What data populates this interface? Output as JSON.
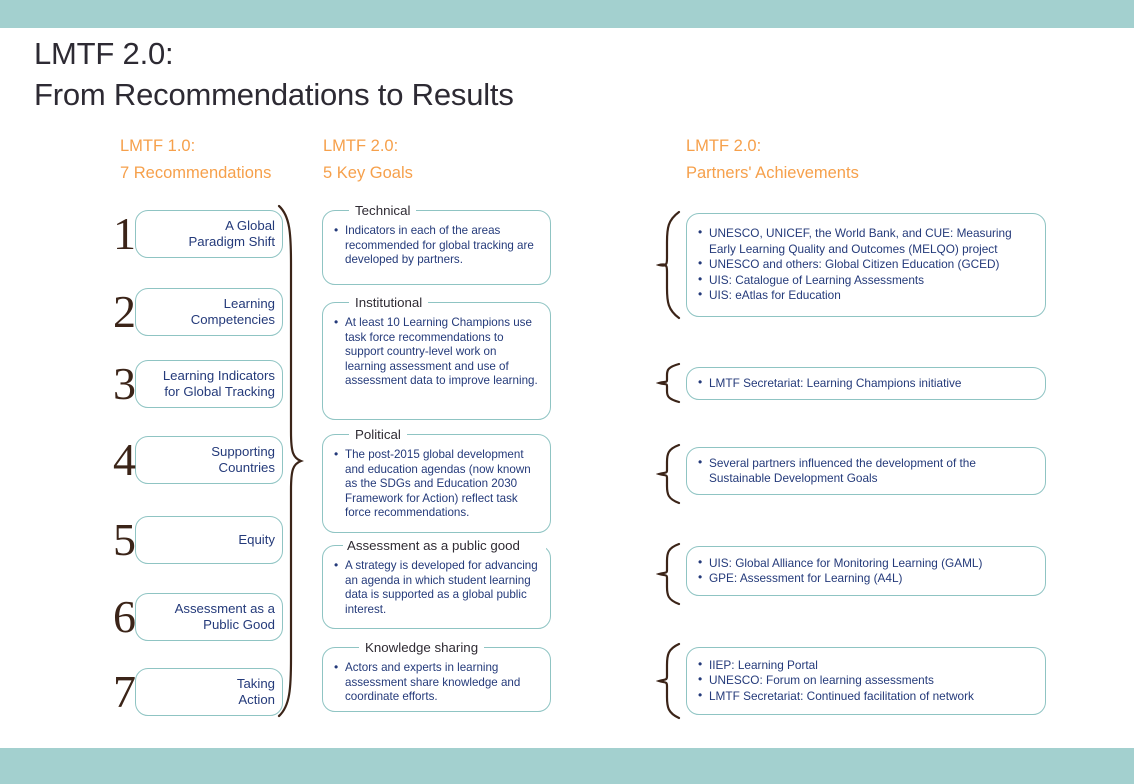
{
  "theme": {
    "band_color": "#a3d0cf",
    "accent_orange": "#f6a04b",
    "box_border": "#8fc4c3",
    "body_text_blue": "#243a7a",
    "numeral_color": "#3b2418",
    "legend_text": "#2f2b33",
    "title_color": "#2d2a33"
  },
  "title": {
    "line1": "LMTF 2.0:",
    "line2": "From Recommendations to Results"
  },
  "columns": {
    "left": {
      "heading_line1": "LMTF 1.0:",
      "heading_line2": "7 Recommendations"
    },
    "middle": {
      "heading_line1": "LMTF 2.0:",
      "heading_line2": "5 Key Goals"
    },
    "right": {
      "heading_line1": "LMTF 2.0:",
      "heading_line2": "Partners' Achievements"
    }
  },
  "recommendations": [
    {
      "number": "1",
      "label_line1": "A Global",
      "label_line2": "Paradigm Shift"
    },
    {
      "number": "2",
      "label_line1": "Learning",
      "label_line2": "Competencies"
    },
    {
      "number": "3",
      "label_line1": "Learning Indicators",
      "label_line2": "for Global Tracking"
    },
    {
      "number": "4",
      "label_line1": "Supporting",
      "label_line2": "Countries"
    },
    {
      "number": "5",
      "label_line1": "Equity",
      "label_line2": ""
    },
    {
      "number": "6",
      "label_line1": "Assessment as a",
      "label_line2": "Public Good"
    },
    {
      "number": "7",
      "label_line1": "Taking",
      "label_line2": "Action"
    }
  ],
  "goals": [
    {
      "legend": "Technical",
      "bullets": [
        "Indicators in each of the areas recommended for global tracking are developed by partners."
      ]
    },
    {
      "legend": "Institutional",
      "bullets": [
        "At least 10 Learning Champions use task force recommendations to support country-level work on learning assessment and use of assessment data to improve learning."
      ]
    },
    {
      "legend": "Political",
      "bullets": [
        "The post-2015 global development and education agendas (now known as the SDGs and Education 2030 Framework for Action) reflect task force recommendations."
      ]
    },
    {
      "legend": "Assessment as a public good",
      "bullets": [
        "A strategy is developed for advancing an agenda in which student learning data is supported as a global public interest."
      ]
    },
    {
      "legend": "Knowledge sharing",
      "bullets": [
        "Actors and experts in learning assessment share knowledge and coordinate efforts."
      ]
    }
  ],
  "achievements": [
    {
      "bullets": [
        "UNESCO, UNICEF, the World Bank, and CUE: Measuring Early Learning Quality and Outcomes (MELQO) project",
        "UNESCO and others: Global Citizen Education (GCED)",
        "UIS: Catalogue of Learning Assessments",
        "UIS: eAtlas for Education"
      ]
    },
    {
      "bullets": [
        "LMTF Secretariat: Learning Champions initiative"
      ]
    },
    {
      "bullets": [
        "Several partners influenced the development of the Sustainable Development Goals"
      ]
    },
    {
      "bullets": [
        "UIS: Global Alliance for Monitoring Learning (GAML)",
        "GPE: Assessment for Learning (A4L)"
      ]
    },
    {
      "bullets": [
        "IIEP: Learning Portal",
        "UNESCO: Forum on learning assessments",
        "LMTF Secretariat: Continued facilitation of network"
      ]
    }
  ]
}
